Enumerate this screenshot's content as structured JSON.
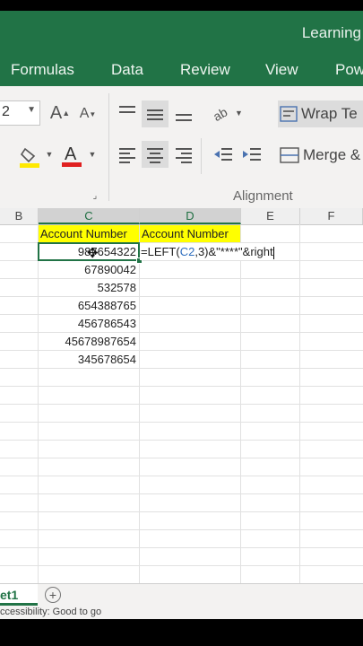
{
  "window": {
    "title": "Learning"
  },
  "tabs": [
    "Formulas",
    "Data",
    "Review",
    "View",
    "Pow"
  ],
  "ribbon": {
    "font_size": "2",
    "wrap_text": "Wrap Te",
    "merge": "Merge &",
    "group_alignment": "Alignment",
    "fill_color": "#ffe900",
    "font_color": "#e02020"
  },
  "columns": [
    "B",
    "C",
    "D",
    "E",
    "F"
  ],
  "cells": {
    "c_header": "Account Number",
    "d_header": "Account Number",
    "c_values": [
      "987654322",
      "67890042",
      "532578",
      "654388765",
      "456786543",
      "45678987654",
      "345678654"
    ],
    "formula_start": "=LEFT(",
    "formula_ref": "C2",
    "formula_end": ",3)&\"****\"&right"
  },
  "sheet": {
    "tab": "et1",
    "add": "+"
  },
  "status": {
    "text": "ccessibility: Good to go"
  }
}
